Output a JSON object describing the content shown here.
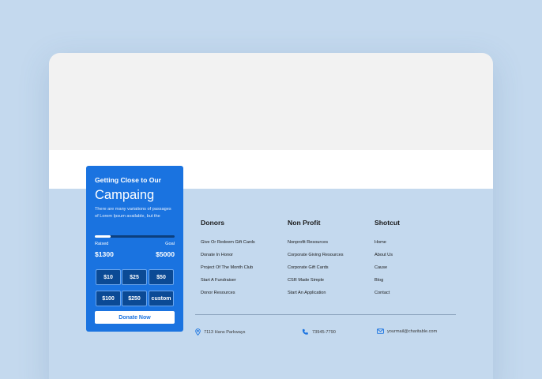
{
  "card": {
    "kicker": "Getting Close to Our",
    "title": "Campaing",
    "description": "There are many variations of passages of Lorem Ipsum available, but the",
    "progress_fraction": 0.2,
    "raised_label": "Raised",
    "goal_label": "Goal",
    "raised_value": "$1300",
    "goal_value": "$5000",
    "amounts": [
      "$10",
      "$25",
      "$50",
      "$100",
      "$250",
      "custom"
    ],
    "donate_label": "Donate Now"
  },
  "columns": [
    {
      "title": "Donors",
      "links": [
        "Give Or Redeem Gift Cards",
        "Donate In Honor",
        "Project Of The Month Club",
        "Start A Fundraiser",
        "Donor Resources"
      ]
    },
    {
      "title": "Non Profit",
      "links": [
        "Nonprofit Resources",
        "Corporate Giving Resources",
        "Corporate Gift Cards",
        "CSR Made Simple",
        "Start An Application"
      ]
    },
    {
      "title": "Shotcut",
      "links": [
        "Home",
        "About Us",
        "Cause",
        "Blog",
        "Contact"
      ]
    }
  ],
  "contacts": {
    "address": "7113 Hans Parkways",
    "phone": "73945-7790",
    "email": "yourmail@charitable.com",
    "icons": [
      "map-pin-icon",
      "phone-icon",
      "mail-icon"
    ]
  },
  "colors": {
    "accent": "#1a73e0",
    "background": "#c4d9ee",
    "button_dark": "#0b4a95"
  }
}
